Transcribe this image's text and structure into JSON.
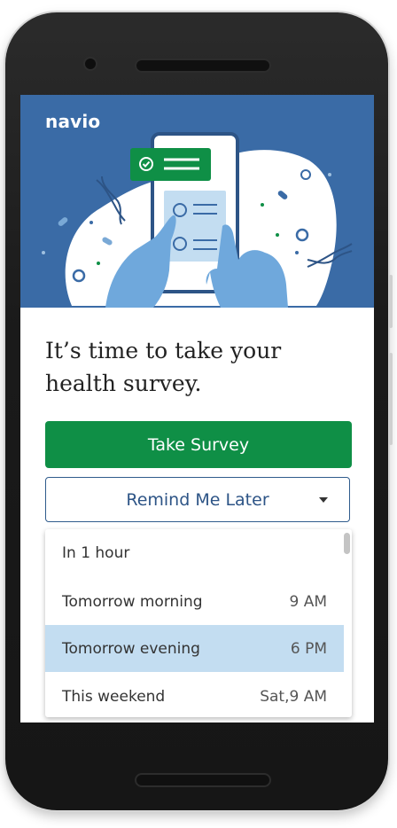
{
  "brand": "navio",
  "headline": "It’s time to take your health survey.",
  "primary_button": "Take Survey",
  "remind_button": "Remind Me Later",
  "options": [
    {
      "label": "In 1 hour",
      "time": ""
    },
    {
      "label": "Tomorrow morning",
      "time": "9 AM"
    },
    {
      "label": "Tomorrow evening",
      "time": "6 PM"
    },
    {
      "label": "This weekend",
      "time": "Sat,9 AM"
    }
  ],
  "selected_option": "Tomorrow evening",
  "colors": {
    "hero_background": "#3a6ba6",
    "primary_green": "#0f8f46",
    "selected_highlight": "#c3ddf1",
    "link_blue": "#2d5486"
  },
  "icons": {
    "check_badge": "check-circle-icon",
    "dropdown": "caret-down-icon"
  }
}
